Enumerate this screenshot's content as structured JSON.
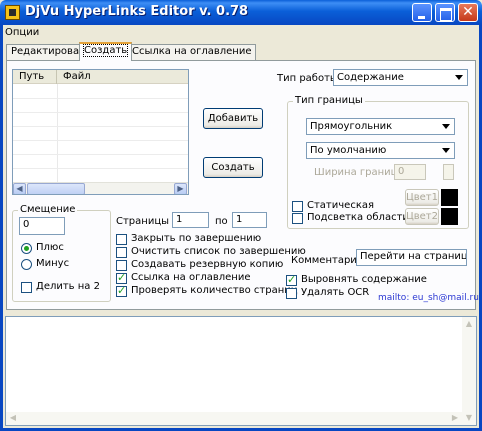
{
  "window": {
    "title": "DjVu HyperLinks Editor v. 0.78"
  },
  "menu": {
    "options_label": "Опции"
  },
  "tabs": [
    {
      "label": "Редактировать",
      "active": false
    },
    {
      "label": "Создать",
      "active": true
    },
    {
      "label": "Ссылка на оглавление",
      "active": false
    }
  ],
  "list": {
    "columns": [
      "Путь",
      "Файл"
    ],
    "rows": []
  },
  "buttons": {
    "add_label": "Добавить",
    "create_label": "Создать"
  },
  "work_type": {
    "label": "Тип работы",
    "value": "Содержание"
  },
  "border_group": {
    "title": "Тип границы",
    "shape_value": "Прямоугольник",
    "style_value": "По умолчанию",
    "width_label": "Ширина границы",
    "width_value": "0",
    "static_label": "Статическая",
    "static_checked": false,
    "highlight_label": "Подсветка области",
    "highlight_checked": false,
    "color1_label": "Цвет1",
    "color2_label": "Цвет2",
    "color1": "#000000",
    "color2": "#000000"
  },
  "offset_group": {
    "title": "Смещение",
    "value": "0",
    "plus_label": "Плюс",
    "minus_label": "Минус",
    "plus_selected": true,
    "divide_label": "Делить на 2",
    "divide_checked": false
  },
  "pages": {
    "from_label": "Страницы с",
    "from_value": "1",
    "to_label": "по",
    "to_value": "1"
  },
  "options": [
    {
      "label": "Закрыть по завершению",
      "checked": false
    },
    {
      "label": "Очистить список по завершению",
      "checked": false
    },
    {
      "label": "Создавать резервную копию",
      "checked": false
    },
    {
      "label": "Ссылка на оглавление",
      "checked": true
    },
    {
      "label": "Проверять количество страниц",
      "checked": true
    }
  ],
  "comment": {
    "label": "Комментарий",
    "value": "Перейти на страницу"
  },
  "align_contents": {
    "label": "Выровнять содержание",
    "checked": true
  },
  "remove_ocr": {
    "label": "Удалять OCR",
    "checked": false
  },
  "contact": {
    "text": "mailto: eu_sh@mail.ru"
  },
  "colors": {
    "titlebar": "#0a5fd8",
    "accent_check": "#21a121",
    "link": "#2c39d3"
  }
}
